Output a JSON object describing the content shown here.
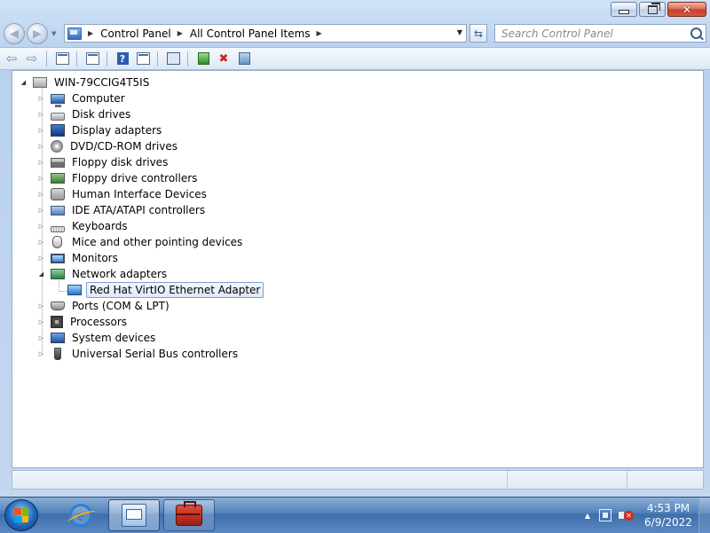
{
  "window": {
    "caption_buttons": {
      "minimize": "minimize",
      "restore": "restore",
      "close": "close"
    }
  },
  "address_bar": {
    "breadcrumbs": [
      "Control Panel",
      "All Control Panel Items"
    ],
    "search_placeholder": "Search Control Panel"
  },
  "toolbar": {
    "icons": [
      "back-arrow-icon",
      "forward-arrow-icon",
      "show-hide-console-tree-icon",
      "properties-icon",
      "help-icon",
      "action-pane-icon",
      "scan-hardware-icon",
      "update-driver-icon",
      "uninstall-icon",
      "disable-device-icon"
    ]
  },
  "device_tree": {
    "root": "WIN-79CCIG4T5IS",
    "categories": [
      {
        "label": "Computer",
        "icon": "computer-icon",
        "expanded": false
      },
      {
        "label": "Disk drives",
        "icon": "disk-drive-icon",
        "expanded": false
      },
      {
        "label": "Display adapters",
        "icon": "display-adapter-icon",
        "expanded": false
      },
      {
        "label": "DVD/CD-ROM drives",
        "icon": "dvd-drive-icon",
        "expanded": false
      },
      {
        "label": "Floppy disk drives",
        "icon": "floppy-disk-icon",
        "expanded": false
      },
      {
        "label": "Floppy drive controllers",
        "icon": "floppy-controller-icon",
        "expanded": false
      },
      {
        "label": "Human Interface Devices",
        "icon": "hid-icon",
        "expanded": false
      },
      {
        "label": "IDE ATA/ATAPI controllers",
        "icon": "ide-controller-icon",
        "expanded": false
      },
      {
        "label": "Keyboards",
        "icon": "keyboard-icon",
        "expanded": false
      },
      {
        "label": "Mice and other pointing devices",
        "icon": "mouse-icon",
        "expanded": false
      },
      {
        "label": "Monitors",
        "icon": "monitor-icon",
        "expanded": false
      },
      {
        "label": "Network adapters",
        "icon": "network-adapter-icon",
        "expanded": true,
        "children": [
          {
            "label": "Red Hat VirtIO Ethernet Adapter",
            "icon": "network-card-icon",
            "selected": true
          }
        ]
      },
      {
        "label": "Ports (COM & LPT)",
        "icon": "port-icon",
        "expanded": false
      },
      {
        "label": "Processors",
        "icon": "processor-icon",
        "expanded": false
      },
      {
        "label": "System devices",
        "icon": "system-device-icon",
        "expanded": false
      },
      {
        "label": "Universal Serial Bus controllers",
        "icon": "usb-icon",
        "expanded": false
      }
    ]
  },
  "taskbar": {
    "pinned": [
      "internet-explorer-icon",
      "control-panel-icon",
      "device-manager-toolbox-icon"
    ],
    "clock": {
      "time": "4:53 PM",
      "date": "6/9/2022"
    }
  },
  "colors": {
    "selection_border": "#7da2ce",
    "taskbar": "#3d6ea9",
    "window_frame": "#b9d1ee"
  }
}
